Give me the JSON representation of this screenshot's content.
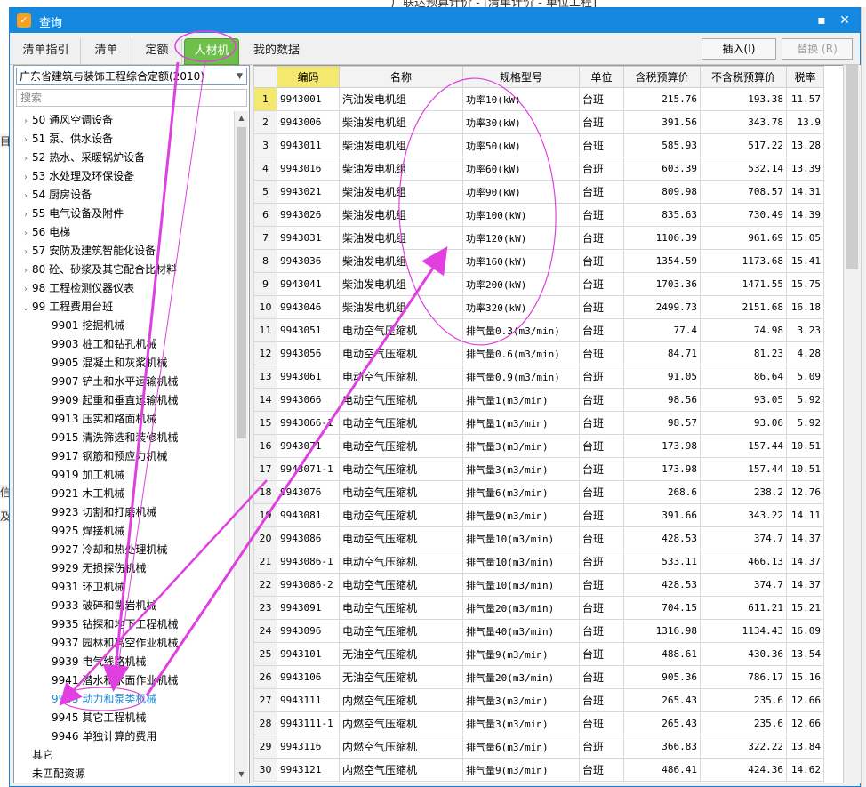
{
  "background": {
    "title_fragment": "广联达预算计价 - [清单计价 - 单位工程]",
    "left_fragments": [
      "目",
      "信",
      "及"
    ]
  },
  "window": {
    "title": "查询",
    "app_icon": "app-logo-icon",
    "minimize_icon": "maximize-icon",
    "close_icon": "close-icon"
  },
  "tabs": [
    {
      "label": "清单指引"
    },
    {
      "label": "清单"
    },
    {
      "label": "定额"
    },
    {
      "label": "人材机"
    },
    {
      "label": "我的数据"
    }
  ],
  "buttons": {
    "insert": "插入(I)",
    "replace": "替换 (R)"
  },
  "left_panel": {
    "library": "广东省建筑与装饰工程综合定额(2010)",
    "search_placeholder": "搜索",
    "tree": [
      {
        "label": "50 通风空调设备",
        "level": 0,
        "expander": "collapsed"
      },
      {
        "label": "51 泵、供水设备",
        "level": 0,
        "expander": "collapsed"
      },
      {
        "label": "52 热水、采暖锅炉设备",
        "level": 0,
        "expander": "collapsed"
      },
      {
        "label": "53 水处理及环保设备",
        "level": 0,
        "expander": "collapsed"
      },
      {
        "label": "54 厨房设备",
        "level": 0,
        "expander": "collapsed"
      },
      {
        "label": "55 电气设备及附件",
        "level": 0,
        "expander": "collapsed"
      },
      {
        "label": "56 电梯",
        "level": 0,
        "expander": "collapsed"
      },
      {
        "label": "57 安防及建筑智能化设备",
        "level": 0,
        "expander": "collapsed"
      },
      {
        "label": "80 砼、砂浆及其它配合比材料",
        "level": 0,
        "expander": "collapsed"
      },
      {
        "label": "98 工程检测仪器仪表",
        "level": 0,
        "expander": "collapsed"
      },
      {
        "label": "99 工程费用台班",
        "level": 0,
        "expander": "expanded"
      },
      {
        "label": "9901 挖掘机械",
        "level": 1
      },
      {
        "label": "9903 桩工和钻孔机械",
        "level": 1
      },
      {
        "label": "9905 混凝土和灰浆机械",
        "level": 1
      },
      {
        "label": "9907 铲土和水平运输机械",
        "level": 1
      },
      {
        "label": "9909 起重和垂直运输机械",
        "level": 1
      },
      {
        "label": "9913 压实和路面机械",
        "level": 1
      },
      {
        "label": "9915 清洗筛选和装修机械",
        "level": 1
      },
      {
        "label": "9917 钢筋和预应力机械",
        "level": 1
      },
      {
        "label": "9919 加工机械",
        "level": 1
      },
      {
        "label": "9921 木工机械",
        "level": 1
      },
      {
        "label": "9923 切割和打磨机械",
        "level": 1
      },
      {
        "label": "9925 焊接机械",
        "level": 1
      },
      {
        "label": "9927 冷却和热处理机械",
        "level": 1
      },
      {
        "label": "9929 无损探伤机械",
        "level": 1
      },
      {
        "label": "9931 环卫机械",
        "level": 1
      },
      {
        "label": "9933 破碎和凿岩机械",
        "level": 1
      },
      {
        "label": "9935 钻探和地下工程机械",
        "level": 1
      },
      {
        "label": "9937 园林和高空作业机械",
        "level": 1
      },
      {
        "label": "9939 电气线路机械",
        "level": 1
      },
      {
        "label": "9941 潜水和水面作业机械",
        "level": 1
      },
      {
        "label": "9943 动力和泵类机械",
        "level": 1,
        "selected": true
      },
      {
        "label": "9945 其它工程机械",
        "level": 1
      },
      {
        "label": "9946 单独计算的费用",
        "level": 1
      },
      {
        "label": "其它",
        "level": 0
      },
      {
        "label": "未匹配资源",
        "level": 0
      }
    ]
  },
  "grid": {
    "columns": [
      "",
      "编码",
      "名称",
      "规格型号",
      "单位",
      "含税预算价",
      "不含税预算价",
      "税率"
    ],
    "rows": [
      [
        "1",
        "9943001",
        "汽油发电机组",
        "功率10(kW)",
        "台班",
        "215.76",
        "193.38",
        "11.57"
      ],
      [
        "2",
        "9943006",
        "柴油发电机组",
        "功率30(kW)",
        "台班",
        "391.56",
        "343.78",
        "13.9"
      ],
      [
        "3",
        "9943011",
        "柴油发电机组",
        "功率50(kW)",
        "台班",
        "585.93",
        "517.22",
        "13.28"
      ],
      [
        "4",
        "9943016",
        "柴油发电机组",
        "功率60(kW)",
        "台班",
        "603.39",
        "532.14",
        "13.39"
      ],
      [
        "5",
        "9943021",
        "柴油发电机组",
        "功率90(kW)",
        "台班",
        "809.98",
        "708.57",
        "14.31"
      ],
      [
        "6",
        "9943026",
        "柴油发电机组",
        "功率100(kW)",
        "台班",
        "835.63",
        "730.49",
        "14.39"
      ],
      [
        "7",
        "9943031",
        "柴油发电机组",
        "功率120(kW)",
        "台班",
        "1106.39",
        "961.69",
        "15.05"
      ],
      [
        "8",
        "9943036",
        "柴油发电机组",
        "功率160(kW)",
        "台班",
        "1354.59",
        "1173.68",
        "15.41"
      ],
      [
        "9",
        "9943041",
        "柴油发电机组",
        "功率200(kW)",
        "台班",
        "1703.36",
        "1471.55",
        "15.75"
      ],
      [
        "10",
        "9943046",
        "柴油发电机组",
        "功率320(kW)",
        "台班",
        "2499.73",
        "2151.68",
        "16.18"
      ],
      [
        "11",
        "9943051",
        "电动空气压缩机",
        "排气量0.3(m3/min)",
        "台班",
        "77.4",
        "74.98",
        "3.23"
      ],
      [
        "12",
        "9943056",
        "电动空气压缩机",
        "排气量0.6(m3/min)",
        "台班",
        "84.71",
        "81.23",
        "4.28"
      ],
      [
        "13",
        "9943061",
        "电动空气压缩机",
        "排气量0.9(m3/min)",
        "台班",
        "91.05",
        "86.64",
        "5.09"
      ],
      [
        "14",
        "9943066",
        "电动空气压缩机",
        "排气量1(m3/min)",
        "台班",
        "98.56",
        "93.05",
        "5.92"
      ],
      [
        "15",
        "9943066-1",
        "电动空气压缩机",
        "排气量1(m3/min)",
        "台班",
        "98.57",
        "93.06",
        "5.92"
      ],
      [
        "16",
        "9943071",
        "电动空气压缩机",
        "排气量3(m3/min)",
        "台班",
        "173.98",
        "157.44",
        "10.51"
      ],
      [
        "17",
        "9943071-1",
        "电动空气压缩机",
        "排气量3(m3/min)",
        "台班",
        "173.98",
        "157.44",
        "10.51"
      ],
      [
        "18",
        "9943076",
        "电动空气压缩机",
        "排气量6(m3/min)",
        "台班",
        "268.6",
        "238.2",
        "12.76"
      ],
      [
        "19",
        "9943081",
        "电动空气压缩机",
        "排气量9(m3/min)",
        "台班",
        "391.66",
        "343.22",
        "14.11"
      ],
      [
        "20",
        "9943086",
        "电动空气压缩机",
        "排气量10(m3/min)",
        "台班",
        "428.53",
        "374.7",
        "14.37"
      ],
      [
        "21",
        "9943086-1",
        "电动空气压缩机",
        "排气量10(m3/min)",
        "台班",
        "533.11",
        "466.13",
        "14.37"
      ],
      [
        "22",
        "9943086-2",
        "电动空气压缩机",
        "排气量10(m3/min)",
        "台班",
        "428.53",
        "374.7",
        "14.37"
      ],
      [
        "23",
        "9943091",
        "电动空气压缩机",
        "排气量20(m3/min)",
        "台班",
        "704.15",
        "611.21",
        "15.21"
      ],
      [
        "24",
        "9943096",
        "电动空气压缩机",
        "排气量40(m3/min)",
        "台班",
        "1316.98",
        "1134.43",
        "16.09"
      ],
      [
        "25",
        "9943101",
        "无油空气压缩机",
        "排气量9(m3/min)",
        "台班",
        "488.61",
        "430.36",
        "13.54"
      ],
      [
        "26",
        "9943106",
        "无油空气压缩机",
        "排气量20(m3/min)",
        "台班",
        "905.36",
        "786.17",
        "15.16"
      ],
      [
        "27",
        "9943111",
        "内燃空气压缩机",
        "排气量3(m3/min)",
        "台班",
        "265.43",
        "235.6",
        "12.66"
      ],
      [
        "28",
        "9943111-1",
        "内燃空气压缩机",
        "排气量3(m3/min)",
        "台班",
        "265.43",
        "235.6",
        "12.66"
      ],
      [
        "29",
        "9943116",
        "内燃空气压缩机",
        "排气量6(m3/min)",
        "台班",
        "366.83",
        "322.22",
        "13.84"
      ],
      [
        "30",
        "9943121",
        "内燃空气压缩机",
        "排气量9(m3/min)",
        "台班",
        "486.41",
        "424.36",
        "14.62"
      ]
    ]
  },
  "colors": {
    "titlebar": "#1588e0",
    "active_tab": "#6fc04a",
    "header_highlight": "#f5e86e",
    "annotation": "#e040e0",
    "selected_tree_text": "#1f8ad8"
  }
}
